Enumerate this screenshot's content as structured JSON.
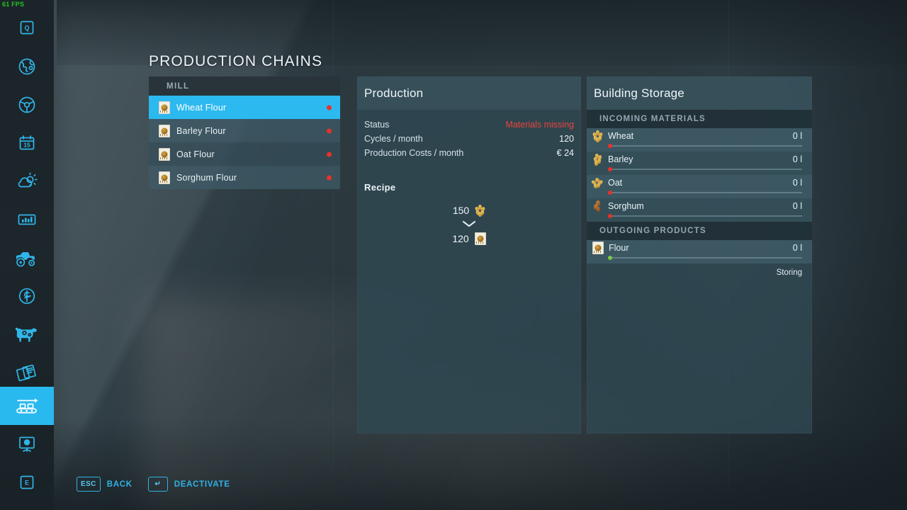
{
  "hud": {
    "fps": "61 FPS"
  },
  "sidebar": {
    "items": [
      {
        "name": "keybind-q",
        "label": "Q",
        "active": false
      },
      {
        "name": "map-globe",
        "label": "",
        "active": false
      },
      {
        "name": "steering-wheel",
        "label": "",
        "active": false
      },
      {
        "name": "calendar",
        "label": "15",
        "active": false
      },
      {
        "name": "weather",
        "label": "",
        "active": false
      },
      {
        "name": "statistics",
        "label": "",
        "active": false
      },
      {
        "name": "vehicles",
        "label": "",
        "active": false
      },
      {
        "name": "finances",
        "label": "",
        "active": false
      },
      {
        "name": "animals",
        "label": "",
        "active": false
      },
      {
        "name": "contracts",
        "label": "",
        "active": false
      },
      {
        "name": "production-chains",
        "label": "",
        "active": true
      },
      {
        "name": "construction",
        "label": "",
        "active": false
      },
      {
        "name": "keybind-e",
        "label": "E",
        "active": false
      }
    ]
  },
  "page": {
    "title": "PRODUCTION CHAINS"
  },
  "chain_list": {
    "group_header": "MILL",
    "rows": [
      {
        "label": "Wheat Flour",
        "status_color": "#e8312b",
        "selected": true
      },
      {
        "label": "Barley Flour",
        "status_color": "#e8312b",
        "selected": false
      },
      {
        "label": "Oat Flour",
        "status_color": "#e8312b",
        "selected": false
      },
      {
        "label": "Sorghum Flour",
        "status_color": "#e8312b",
        "selected": false
      }
    ]
  },
  "production": {
    "title": "Production",
    "stats": [
      {
        "label": "Status",
        "value": "Materials missing",
        "warn": true
      },
      {
        "label": "Cycles / month",
        "value": "120",
        "warn": false
      },
      {
        "label": "Production Costs / month",
        "value": "€ 24",
        "warn": false
      }
    ],
    "recipe_title": "Recipe",
    "recipe": {
      "input": {
        "amount": "150",
        "icon": "wheat-grain-icon"
      },
      "output": {
        "amount": "120",
        "icon": "flour-sack-icon"
      }
    }
  },
  "storage": {
    "title": "Building Storage",
    "incoming_header": "INCOMING MATERIALS",
    "incoming": [
      {
        "name": "Wheat",
        "amount": "0 l",
        "fill_color": "#e8312b",
        "fill_pct": 0
      },
      {
        "name": "Barley",
        "amount": "0 l",
        "fill_color": "#e8312b",
        "fill_pct": 0
      },
      {
        "name": "Oat",
        "amount": "0 l",
        "fill_color": "#e8312b",
        "fill_pct": 0
      },
      {
        "name": "Sorghum",
        "amount": "0 l",
        "fill_color": "#e8312b",
        "fill_pct": 0
      }
    ],
    "outgoing_header": "OUTGOING PRODUCTS",
    "outgoing": [
      {
        "name": "Flour",
        "amount": "0 l",
        "fill_color": "#7ac943",
        "fill_pct": 0,
        "mode": "Storing"
      }
    ]
  },
  "hints": [
    {
      "key": "ESC",
      "label": "BACK"
    },
    {
      "key": "↵",
      "label": "DEACTIVATE"
    }
  ],
  "colors": {
    "accent": "#2cb9ef",
    "warn": "#e8453c",
    "ok": "#7ac943",
    "panel": "#2f4853"
  }
}
